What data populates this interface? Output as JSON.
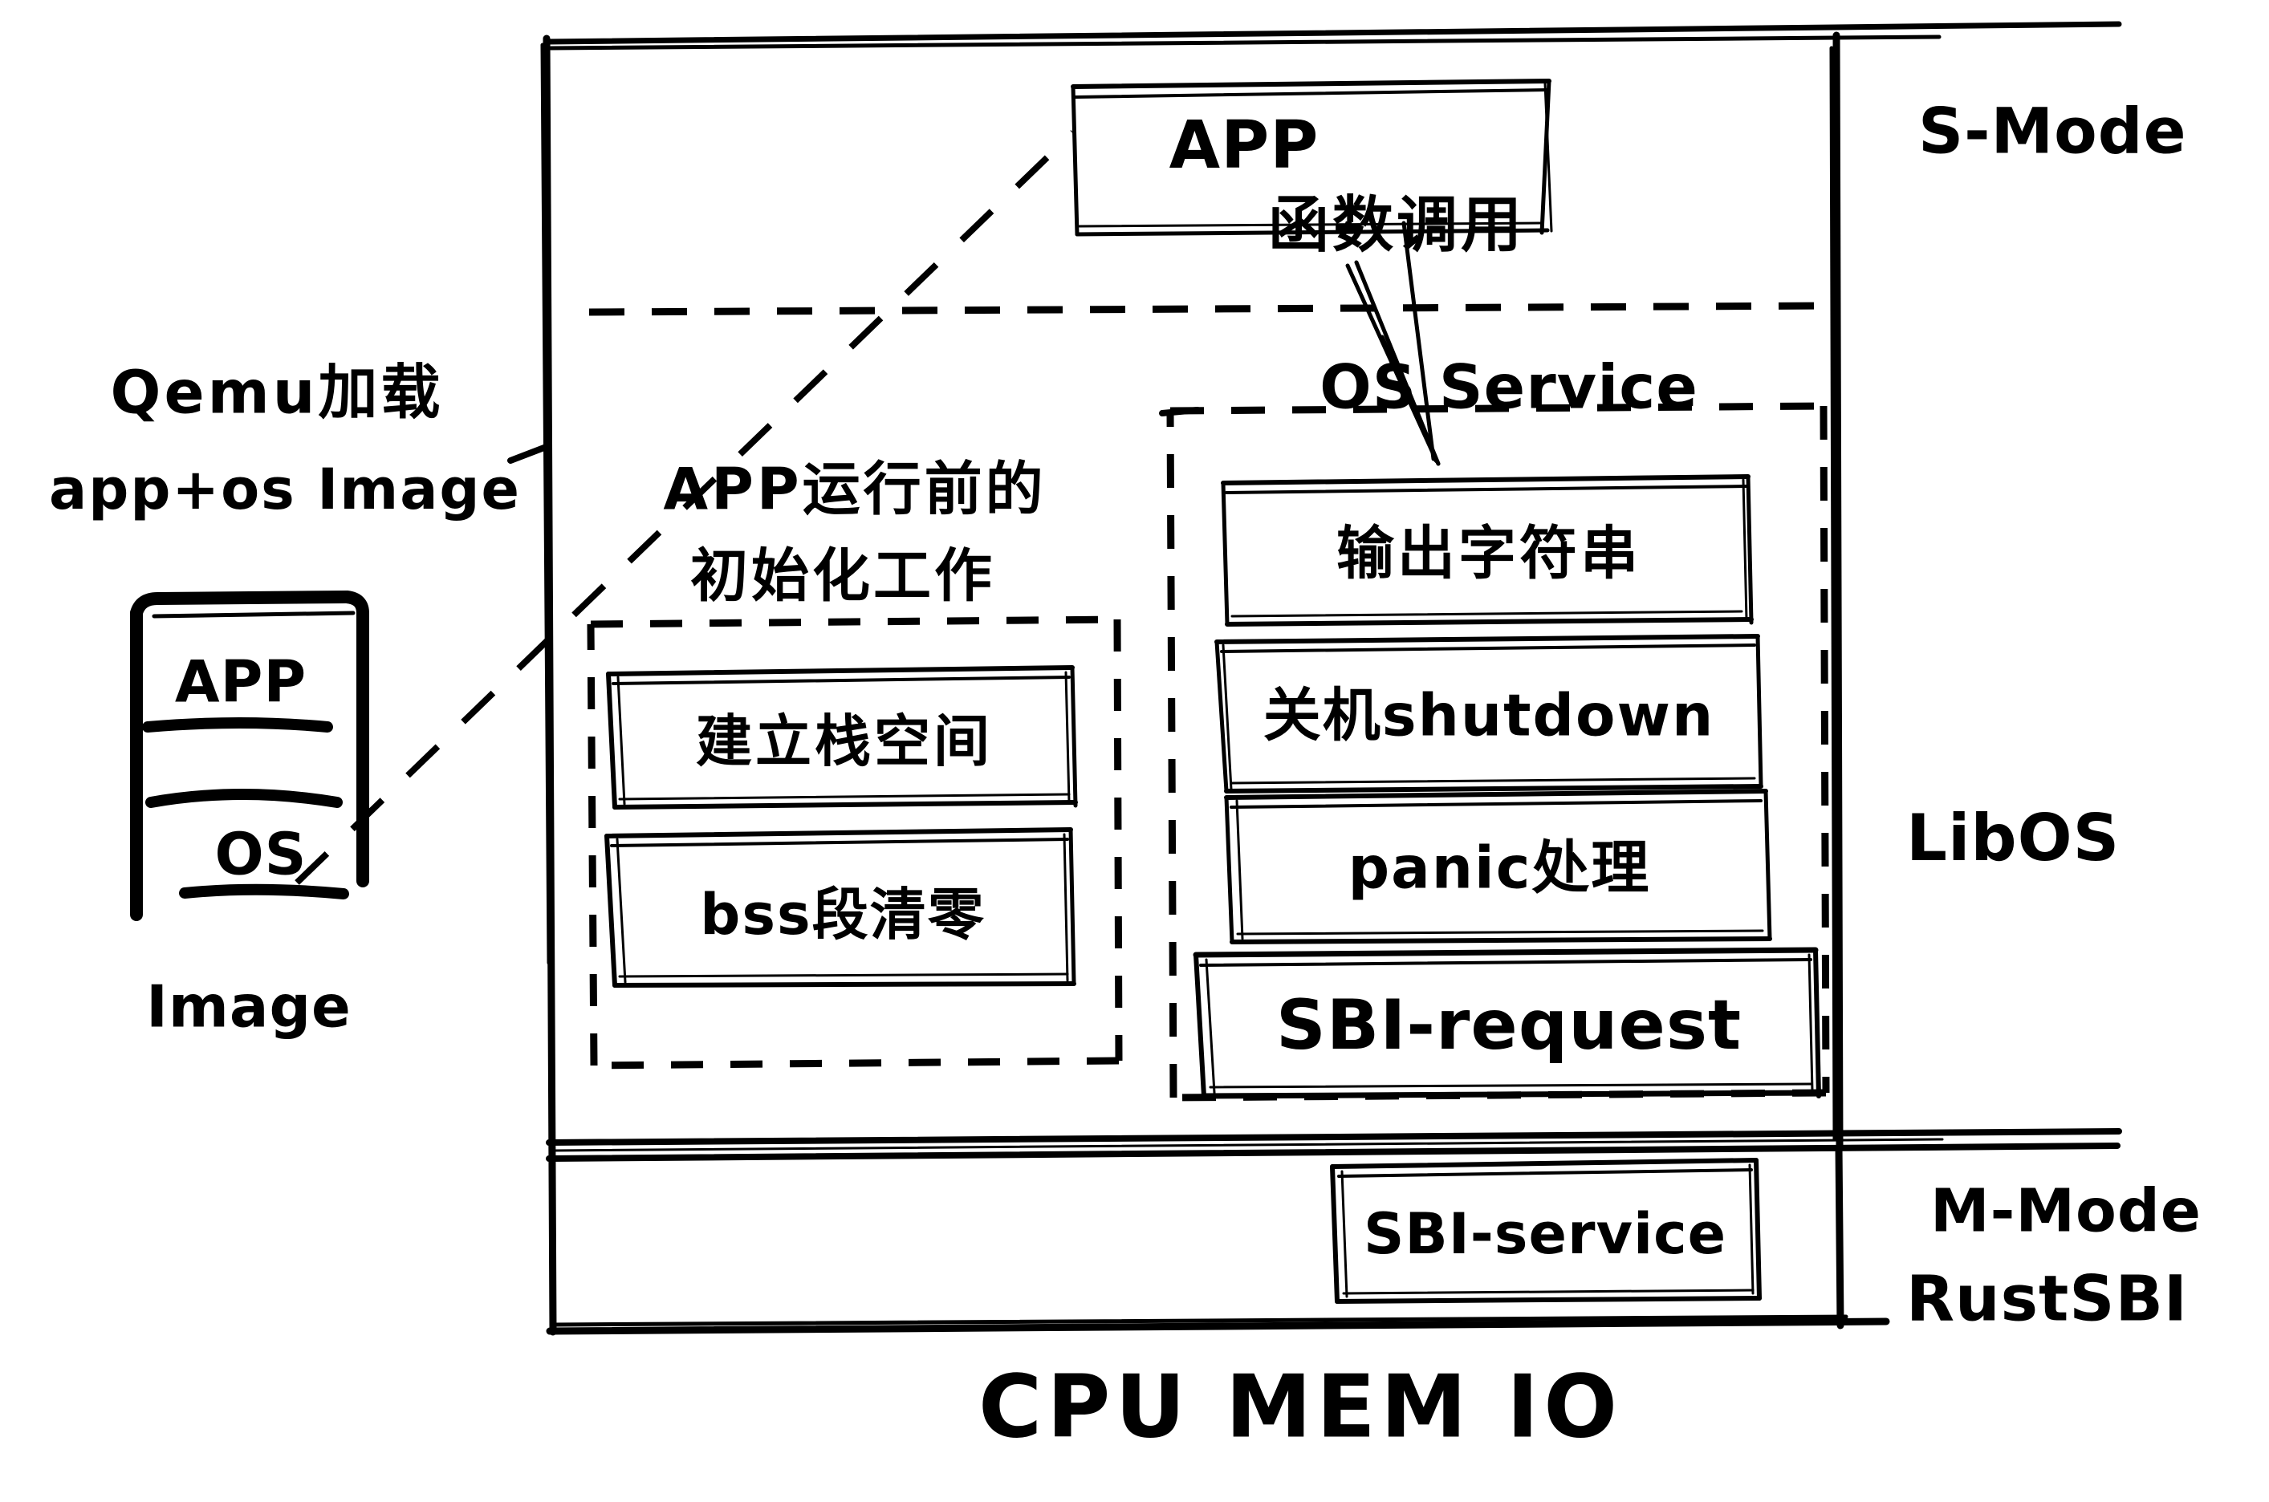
{
  "diagram": {
    "title": "LibOS / RustSBI layered architecture (hand-drawn)",
    "background": "#ffffff",
    "ink": "#000000"
  },
  "left_annotations": {
    "qemu_load_line1": "Qemu加载",
    "qemu_load_line2": "app+os Image",
    "image_box": {
      "app_label": "APP",
      "os_label": "OS",
      "caption": "Image"
    }
  },
  "top": {
    "app_box_label": "APP",
    "function_call_label": "函数调用"
  },
  "libos": {
    "init_section": {
      "title_line1": "APP运行前的",
      "title_line2": "初始化工作",
      "items": [
        {
          "label": "建立栈空间"
        },
        {
          "label": "bss段清零"
        }
      ]
    },
    "os_service_section": {
      "title": "OS Service",
      "items": [
        {
          "label": "输出字符串"
        },
        {
          "label": "关机shutdown"
        },
        {
          "label": "panic处理"
        },
        {
          "label": "SBI-request"
        }
      ]
    }
  },
  "mmode": {
    "service_box_label": "SBI-service"
  },
  "right_labels": {
    "s_mode": "S-Mode",
    "libos": "LibOS",
    "m_mode": "M-Mode",
    "rustsbi": "RustSBI"
  },
  "bottom": {
    "hardware_label": "CPU  MEM  IO"
  }
}
